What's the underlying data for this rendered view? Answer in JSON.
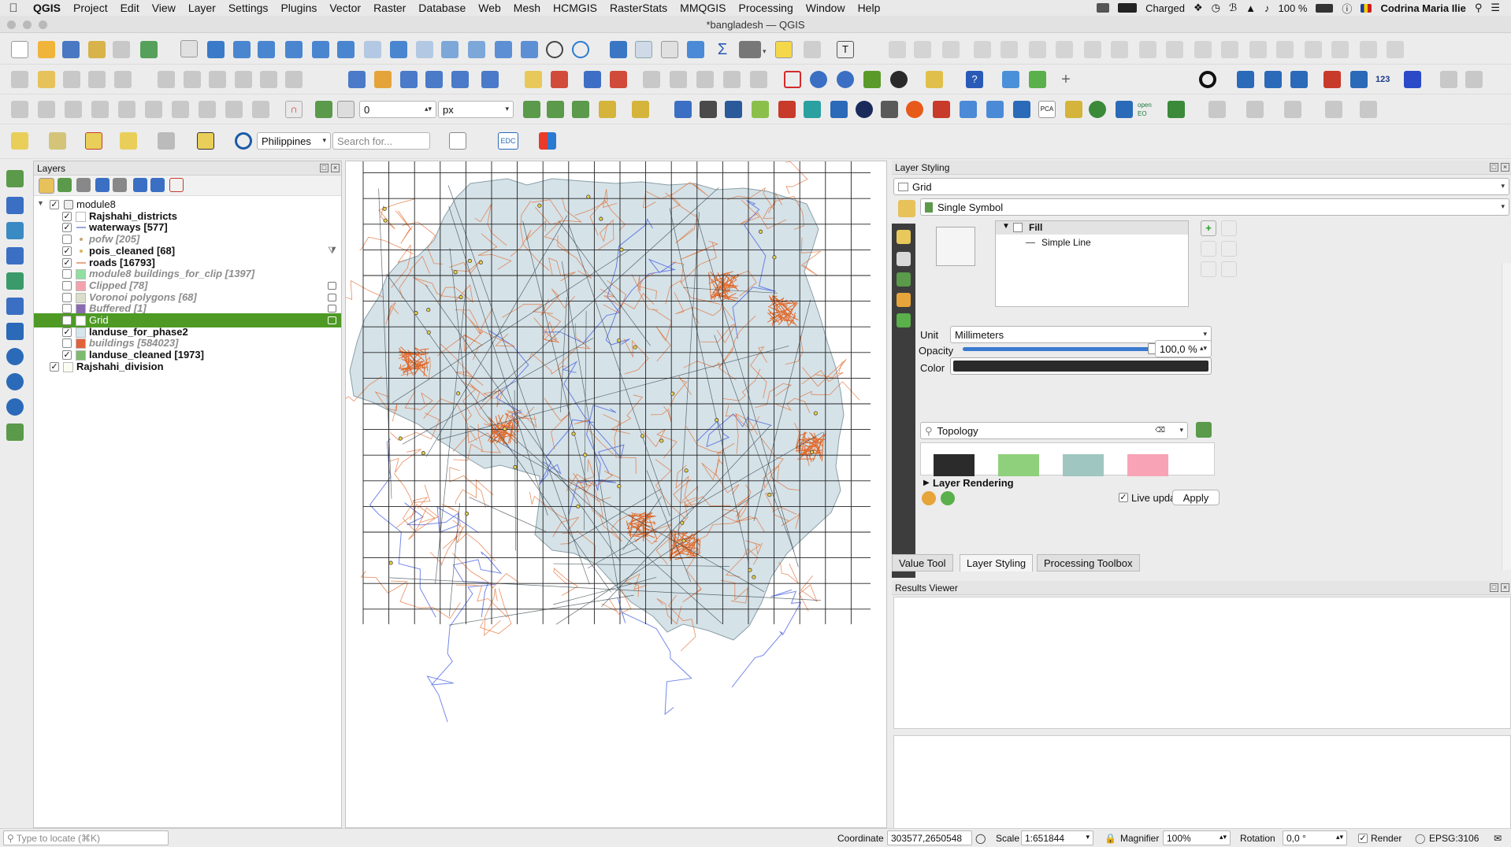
{
  "menubar": {
    "app": "QGIS",
    "items": [
      "Project",
      "Edit",
      "View",
      "Layer",
      "Settings",
      "Plugins",
      "Vector",
      "Raster",
      "Database",
      "Web",
      "Mesh",
      "HCMGIS",
      "RasterStats",
      "MMQGIS",
      "Processing",
      "Window",
      "Help"
    ],
    "status": {
      "battery_label": "Charged",
      "battery_pct": "100 %",
      "user": "Codrina Maria Ilie"
    }
  },
  "window": {
    "title": "*bangladesh — QGIS"
  },
  "toolbar": {
    "snap_tolerance": "0",
    "snap_unit": "px",
    "locator_country": "Philippines",
    "search_placeholder": "Search for...",
    "edc_label": "EDC"
  },
  "layers_panel": {
    "title": "Layers",
    "group": "module8",
    "layers": [
      {
        "name": "Rajshahi_districts",
        "checked": true,
        "style": "visible",
        "symbol": "fill",
        "color": "#ffffff"
      },
      {
        "name": "waterways [577]",
        "checked": true,
        "style": "visible",
        "symbol": "line",
        "color": "#9aa5d8"
      },
      {
        "name": "pofw [205]",
        "checked": false,
        "style": "hidden",
        "symbol": "point",
        "color": "#c7a67a"
      },
      {
        "name": "pois_cleaned [68]",
        "checked": true,
        "style": "visible",
        "symbol": "point",
        "color": "#d6b65a",
        "filter": true
      },
      {
        "name": "roads [16793]",
        "checked": true,
        "style": "visible",
        "symbol": "line",
        "color": "#e8a78a"
      },
      {
        "name": "module8 buildings_for_clip [1397]",
        "checked": false,
        "style": "hidden",
        "symbol": "fill",
        "color": "#8fe0a0"
      },
      {
        "name": "Clipped [78]",
        "checked": false,
        "style": "hidden",
        "symbol": "fill",
        "color": "#f4a3ad",
        "badge": true
      },
      {
        "name": "Voronoi polygons [68]",
        "checked": false,
        "style": "hidden",
        "symbol": "fill",
        "color": "#d9dec9",
        "badge": true
      },
      {
        "name": "Buffered [1]",
        "checked": false,
        "style": "hidden",
        "symbol": "fill",
        "color": "#8a6ab0",
        "badge": true
      },
      {
        "name": "Grid",
        "checked": true,
        "style": "selected",
        "symbol": "fill",
        "color": "#ffffff",
        "badge": true
      },
      {
        "name": "landuse_for_phase2",
        "checked": true,
        "style": "visible",
        "symbol": "fill",
        "color": "#d4e6ec"
      },
      {
        "name": "buildings [584023]",
        "checked": false,
        "style": "hidden",
        "symbol": "fill",
        "color": "#e4623a"
      },
      {
        "name": "landuse_cleaned [1973]",
        "checked": true,
        "style": "visible",
        "symbol": "fill",
        "color": "#7cbb6c"
      }
    ],
    "root_layer": {
      "name": "Rajshahi_division",
      "checked": true
    }
  },
  "styling_panel": {
    "title": "Layer Styling",
    "layer": "Grid",
    "renderer": "Single Symbol",
    "tree_fill": "Fill",
    "tree_line": "Simple Line",
    "unit_label": "Unit",
    "unit_value": "Millimeters",
    "opacity_label": "Opacity",
    "opacity_value": "100,0 %",
    "opacity_fraction": 1.0,
    "color_label": "Color",
    "color_value": "#2a2a2a",
    "library_search": "Topology",
    "swatches": [
      "#2b2b2b",
      "#8fd07c",
      "#9fc6c0",
      "#f8a3b6"
    ],
    "layer_rendering": "Layer Rendering",
    "live_update": "Live update",
    "apply": "Apply"
  },
  "bottom_tabs": [
    "Value Tool",
    "Layer Styling",
    "Processing Toolbox"
  ],
  "results_panel": {
    "title": "Results Viewer"
  },
  "statusbar": {
    "locate_placeholder": "Type to locate (⌘K)",
    "coordinate_label": "Coordinate",
    "coordinate": "303577,2650548",
    "scale_label": "Scale",
    "scale": "1:651844",
    "magnifier_label": "Magnifier",
    "magnifier": "100%",
    "rotation_label": "Rotation",
    "rotation": "0,0 °",
    "render_label": "Render",
    "crs": "EPSG:3106"
  },
  "map": {
    "land_color": "#d5e2e8",
    "road_color": "#e06a2c",
    "water_color": "#3a55e0",
    "grid_color": "#222222"
  }
}
